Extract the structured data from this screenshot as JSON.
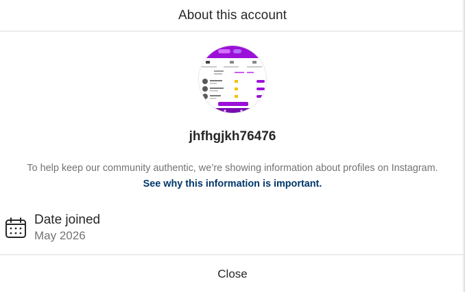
{
  "dialog": {
    "title": "About this account"
  },
  "profile": {
    "username": "jhfhgjkh76476",
    "info_text": "To help keep our community authentic, we’re showing information about profiles on Instagram.",
    "info_link": "See why this information is important."
  },
  "details": {
    "date_joined_label": "Date joined",
    "date_joined_value": "May 2026",
    "icon": "calendar-icon"
  },
  "footer": {
    "close_label": "Close"
  },
  "colors": {
    "text_primary": "#262626",
    "text_secondary": "#737373",
    "link": "#00376b",
    "divider": "#dbdbdb",
    "avatar_accent": "#9b10d8"
  }
}
